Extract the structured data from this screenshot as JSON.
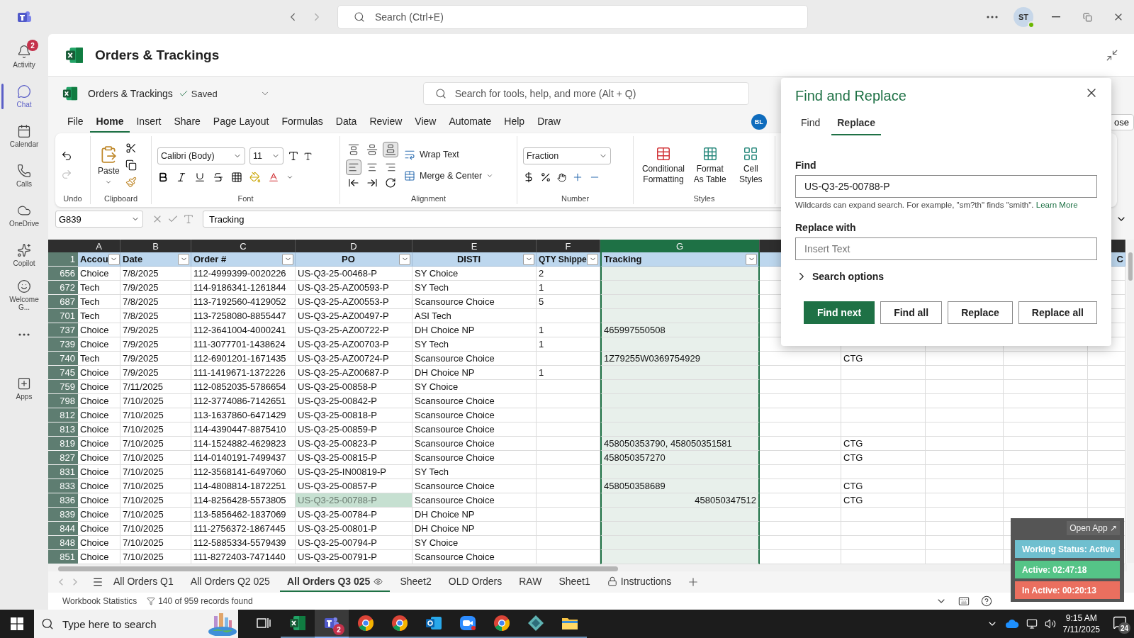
{
  "top_bar": {
    "search_placeholder": "Search (Ctrl+E)",
    "avatar": "ST"
  },
  "rail": [
    {
      "label": "Activity",
      "kind": "activity",
      "selected": false,
      "badge": "2"
    },
    {
      "label": "Chat",
      "kind": "chat",
      "selected": true
    },
    {
      "label": "Calendar",
      "kind": "calendar",
      "selected": false
    },
    {
      "label": "Calls",
      "kind": "calls",
      "selected": false
    },
    {
      "label": "OneDrive",
      "kind": "onedrive",
      "selected": false
    },
    {
      "label": "Copilot",
      "kind": "copilot",
      "selected": false
    },
    {
      "label": "Welcome G...",
      "kind": "welcome",
      "selected": false
    },
    {
      "kind": "more",
      "selected": false
    },
    {
      "label": "Apps",
      "kind": "apps",
      "selected": false
    }
  ],
  "page_title": "Orders & Trackings",
  "workbook": {
    "name": "Orders & Trackings",
    "status": "Saved",
    "search_placeholder": "Search for tools, help, and more (Alt + Q)"
  },
  "menu": [
    {
      "label": "File",
      "selected": false
    },
    {
      "label": "Home",
      "selected": true
    },
    {
      "label": "Insert",
      "selected": false
    },
    {
      "label": "Share",
      "selected": false
    },
    {
      "label": "Page Layout",
      "selected": false
    },
    {
      "label": "Formulas",
      "selected": false
    },
    {
      "label": "Data",
      "selected": false
    },
    {
      "label": "Review",
      "selected": false
    },
    {
      "label": "View",
      "selected": false
    },
    {
      "label": "Automate",
      "selected": false
    },
    {
      "label": "Help",
      "selected": false
    },
    {
      "label": "Draw",
      "selected": false
    }
  ],
  "collaborator": "BL",
  "side_button": "ose",
  "ribbon": {
    "undo": "Undo",
    "clipboard": "Clipboard",
    "paste": "Paste",
    "font": "Font",
    "font_name": "Calibri (Body)",
    "font_size": "11",
    "alignment": "Alignment",
    "vertical_align": [
      {
        "selected": false
      },
      {
        "selected": false
      },
      {
        "selected": true
      }
    ],
    "horizontal_align": [
      {
        "selected": true
      },
      {
        "selected": false
      },
      {
        "selected": false
      }
    ],
    "wrap_text": "Wrap Text",
    "merge": "Merge & Center",
    "number": "Number",
    "number_format": "Fraction",
    "styles": "Styles",
    "style_buttons": [
      {
        "label": "Conditional Formatting",
        "kind": "conditional"
      },
      {
        "label": "Format As Table",
        "kind": "table"
      },
      {
        "label": "Cell Styles",
        "kind": "cell"
      }
    ]
  },
  "formula_bar": {
    "name_box": "G839",
    "formula": "Tracking"
  },
  "columns": [
    {
      "letter": "A",
      "header": "Accou",
      "filter": true,
      "selected": false,
      "centered": false
    },
    {
      "letter": "B",
      "header": "Date",
      "filter": true,
      "selected": false,
      "centered": false
    },
    {
      "letter": "C",
      "header": "Order #",
      "filter": true,
      "selected": false,
      "centered": false
    },
    {
      "letter": "D",
      "header": "PO",
      "filter": true,
      "selected": false,
      "centered": true
    },
    {
      "letter": "E",
      "header": "DISTI",
      "filter": true,
      "selected": false,
      "centered": true
    },
    {
      "letter": "F",
      "header": "QTY Shippe",
      "filter": true,
      "selected": false,
      "centered": false
    },
    {
      "letter": "G",
      "header": "Tracking",
      "filter": true,
      "selected": true,
      "centered": false
    }
  ],
  "last_column_header": "C",
  "header_row": "1",
  "rows": [
    {
      "number": "656",
      "account": "Choice",
      "date": "7/8/2025",
      "order": "112-4999399-0020226",
      "po": "US-Q3-25-00468-P",
      "disti": "SY Choice",
      "qty": "2",
      "match": false
    },
    {
      "number": "672",
      "account": "Tech",
      "date": "7/9/2025",
      "order": "114-9186341-1261844",
      "po": "US-Q3-25-AZ00593-P",
      "disti": "SY Tech",
      "qty": "1",
      "match": false
    },
    {
      "number": "687",
      "account": "Tech",
      "date": "7/8/2025",
      "order": "113-7192560-4129052",
      "po": "US-Q3-25-AZ00553-P",
      "disti": "Scansource Choice",
      "qty": "5",
      "match": false
    },
    {
      "number": "701",
      "account": "Tech",
      "date": "7/8/2025",
      "order": "113-7258080-8855447",
      "po": "US-Q3-25-AZ00497-P",
      "disti": "ASI Tech",
      "match": false
    },
    {
      "number": "737",
      "account": "Choice",
      "date": "7/9/2025",
      "order": "112-3641004-4000241",
      "po": "US-Q3-25-AZ00722-P",
      "disti": "DH Choice NP",
      "qty": "1",
      "tracking": "465997550508",
      "tracking_right": false,
      "match": false
    },
    {
      "number": "739",
      "account": "Choice",
      "date": "7/9/2025",
      "order": "111-3077701-1438624",
      "po": "US-Q3-25-AZ00703-P",
      "disti": "SY Tech",
      "qty": "1",
      "match": false
    },
    {
      "number": "740",
      "account": "Tech",
      "date": "7/9/2025",
      "order": "112-6901201-1671435",
      "po": "US-Q3-25-AZ00724-P",
      "disti": "Scansource Choice",
      "tracking": "1Z79255W0369754929",
      "tracking_right": false,
      "column_i": "CTG",
      "match": false
    },
    {
      "number": "745",
      "account": "Choice",
      "date": "7/9/2025",
      "order": "111-1419671-1372226",
      "po": "US-Q3-25-AZ00687-P",
      "disti": "DH Choice NP",
      "qty": "1",
      "match": false
    },
    {
      "number": "759",
      "account": "Choice",
      "date": "7/11/2025",
      "order": "112-0852035-5786654",
      "po": "US-Q3-25-00858-P",
      "disti": "SY Choice",
      "match": false
    },
    {
      "number": "798",
      "account": "Choice",
      "date": "7/10/2025",
      "order": "112-3774086-7142651",
      "po": "US-Q3-25-00842-P",
      "disti": "Scansource Choice",
      "match": false
    },
    {
      "number": "812",
      "account": "Choice",
      "date": "7/10/2025",
      "order": "113-1637860-6471429",
      "po": "US-Q3-25-00818-P",
      "disti": "Scansource Choice",
      "match": false
    },
    {
      "number": "813",
      "account": "Choice",
      "date": "7/10/2025",
      "order": "114-4390447-8875410",
      "po": "US-Q3-25-00859-P",
      "disti": "Scansource Choice",
      "match": false
    },
    {
      "number": "819",
      "account": "Choice",
      "date": "7/10/2025",
      "order": "114-1524882-4629823",
      "po": "US-Q3-25-00823-P",
      "disti": "Scansource Choice",
      "tracking": "458050353790, 458050351581",
      "tracking_right": false,
      "column_i": "CTG",
      "match": false
    },
    {
      "number": "827",
      "account": "Choice",
      "date": "7/10/2025",
      "order": "114-0140191-7499437",
      "po": "US-Q3-25-00815-P",
      "disti": "Scansource Choice",
      "tracking": "458050357270",
      "tracking_right": false,
      "column_i": "CTG",
      "match": false
    },
    {
      "number": "831",
      "account": "Choice",
      "date": "7/10/2025",
      "order": "112-3568141-6497060",
      "po": "US-Q3-25-IN00819-P",
      "disti": "SY Tech",
      "match": false
    },
    {
      "number": "833",
      "account": "Choice",
      "date": "7/10/2025",
      "order": "114-4808814-1872251",
      "po": "US-Q3-25-00857-P",
      "disti": "Scansource Choice",
      "tracking": "458050358689",
      "tracking_right": false,
      "column_i": "CTG",
      "match": false
    },
    {
      "number": "836",
      "account": "Choice",
      "date": "7/10/2025",
      "order": "114-8256428-5573805",
      "po": "US-Q3-25-00788-P",
      "disti": "Scansource Choice",
      "tracking": "458050347512",
      "tracking_right": true,
      "column_i": "CTG",
      "match": true
    },
    {
      "number": "839",
      "account": "Choice",
      "date": "7/10/2025",
      "order": "113-5856462-1837069",
      "po": "US-Q3-25-00784-P",
      "disti": "DH Choice NP",
      "match": false
    },
    {
      "number": "844",
      "account": "Choice",
      "date": "7/10/2025",
      "order": "111-2756372-1867445",
      "po": "US-Q3-25-00801-P",
      "disti": "DH Choice NP",
      "match": false
    },
    {
      "number": "848",
      "account": "Choice",
      "date": "7/10/2025",
      "order": "112-5885334-5579439",
      "po": "US-Q3-25-00794-P",
      "disti": "SY Choice",
      "match": false
    },
    {
      "number": "851",
      "account": "Choice",
      "date": "7/10/2025",
      "order": "111-8272403-7471440",
      "po": "US-Q3-25-00791-P",
      "disti": "Scansource Choice",
      "match": false
    }
  ],
  "sheets": [
    {
      "label": "All Orders Q1",
      "selected": false
    },
    {
      "label": "All Orders Q2 025",
      "selected": false
    },
    {
      "label": "All Orders Q3 025",
      "selected": true,
      "kind": "watched"
    },
    {
      "label": "Sheet2",
      "selected": false
    },
    {
      "label": "OLD Orders",
      "selected": false
    },
    {
      "label": "RAW",
      "selected": false
    },
    {
      "label": "Sheet1",
      "selected": false
    },
    {
      "label": "Instructions",
      "selected": false,
      "kind": "locked"
    }
  ],
  "status_bar": {
    "statistics": "Workbook Statistics",
    "records": "140 of 959 records found"
  },
  "find_replace": {
    "title": "Find and Replace",
    "tabs": [
      {
        "label": "Find",
        "selected": false
      },
      {
        "label": "Replace",
        "selected": true
      }
    ],
    "find_label": "Find",
    "find_value": "US-Q3-25-00788-P",
    "hint": "Wildcards can expand search. For example, \"sm?th\" finds \"smith\".",
    "hint_link": "Learn More",
    "replace_label": "Replace with",
    "replace_placeholder": "Insert Text",
    "options": "Search options",
    "options_expanded": false,
    "buttons": [
      {
        "label": "Find next",
        "kind": "primary"
      },
      {
        "label": "Find all",
        "kind": "default"
      },
      {
        "label": "Replace",
        "kind": "default"
      },
      {
        "label": "Replace all",
        "kind": "default"
      }
    ]
  },
  "tracker": {
    "open_app": "Open App ↗",
    "rows": [
      {
        "label": "Working Status: Active",
        "color": "#6fbfcf"
      },
      {
        "label": "Active: 02:47:18",
        "color": "#55c487"
      },
      {
        "label": "In Active: 00:20:13",
        "color": "#ea6f5f"
      }
    ]
  },
  "taskbar": {
    "search_placeholder": "Type here to search",
    "apps": [
      {
        "kind": "taskview",
        "selected": false
      },
      {
        "kind": "excel",
        "selected": false
      },
      {
        "kind": "teams",
        "selected": true,
        "badge": "2"
      },
      {
        "kind": "browser",
        "selected": false
      },
      {
        "kind": "browser",
        "selected": false
      },
      {
        "kind": "mail",
        "selected": false
      },
      {
        "kind": "video",
        "selected": false
      },
      {
        "kind": "browser",
        "selected": false
      },
      {
        "kind": "diamond",
        "selected": false
      },
      {
        "kind": "folder",
        "selected": false
      }
    ],
    "time": "9:15 AM",
    "date": "7/11/2025",
    "notifications": "24"
  }
}
